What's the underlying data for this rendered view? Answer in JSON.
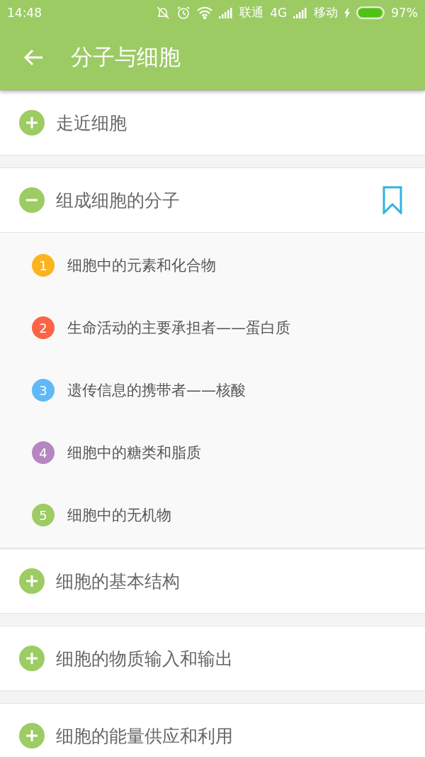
{
  "status_bar": {
    "time": "14:48",
    "carrier_1": "联通",
    "network": "4G",
    "carrier_2": "移动",
    "battery": "97%"
  },
  "app_bar": {
    "title": "分子与细胞"
  },
  "chapters": [
    {
      "title": "走近细胞",
      "expanded": false,
      "bookmarked": false
    },
    {
      "title": "组成细胞的分子",
      "expanded": true,
      "bookmarked": true,
      "sections": [
        {
          "number": "1",
          "title": "细胞中的元素和化合物",
          "color": "#fbb41e"
        },
        {
          "number": "2",
          "title": "生命活动的主要承担者——蛋白质",
          "color": "#fb6444"
        },
        {
          "number": "3",
          "title": "遗传信息的携带者——核酸",
          "color": "#5fb9f6"
        },
        {
          "number": "4",
          "title": "细胞中的糖类和脂质",
          "color": "#b586c1"
        },
        {
          "number": "5",
          "title": "细胞中的无机物",
          "color": "#9ccc63"
        }
      ]
    },
    {
      "title": "细胞的基本结构",
      "expanded": false,
      "bookmarked": false
    },
    {
      "title": "细胞的物质输入和输出",
      "expanded": false,
      "bookmarked": false
    },
    {
      "title": "细胞的能量供应和利用",
      "expanded": false,
      "bookmarked": false
    }
  ]
}
